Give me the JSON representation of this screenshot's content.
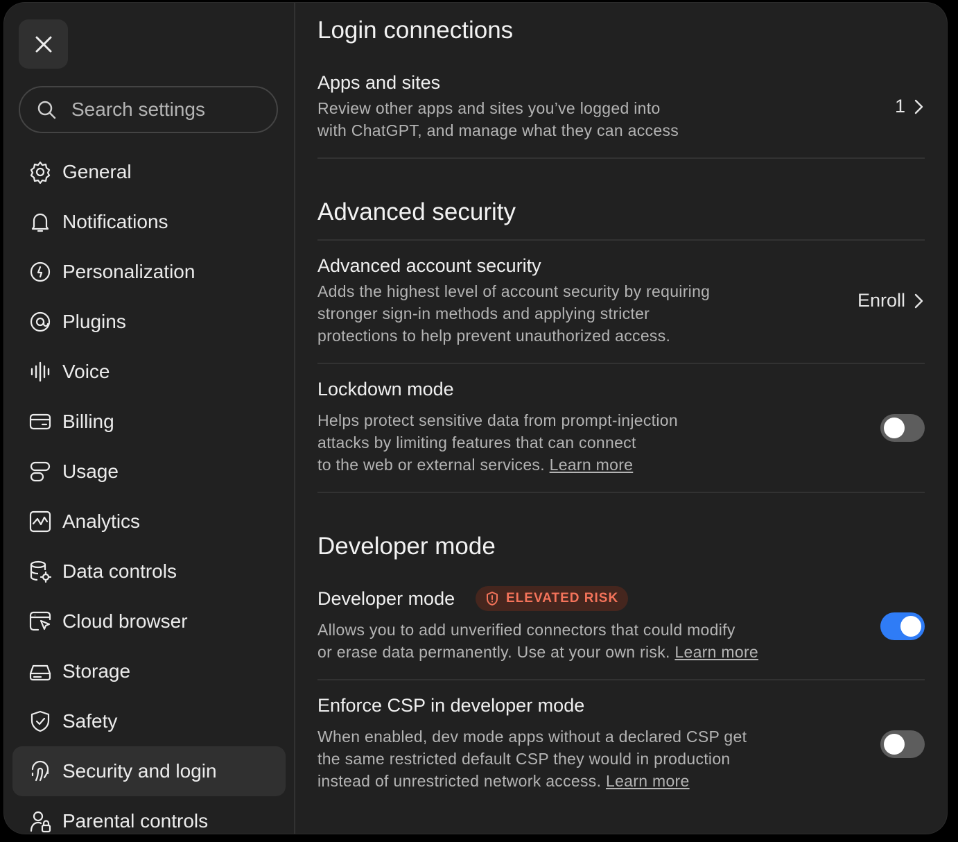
{
  "sidebar": {
    "search_placeholder": "Search settings",
    "items": [
      {
        "label": "General",
        "icon": "gear-icon"
      },
      {
        "label": "Notifications",
        "icon": "bell-icon"
      },
      {
        "label": "Personalization",
        "icon": "personalization-icon"
      },
      {
        "label": "Plugins",
        "icon": "plugins-icon"
      },
      {
        "label": "Voice",
        "icon": "voice-waveform-icon"
      },
      {
        "label": "Billing",
        "icon": "credit-card-icon"
      },
      {
        "label": "Usage",
        "icon": "usage-icon"
      },
      {
        "label": "Analytics",
        "icon": "analytics-chart-icon"
      },
      {
        "label": "Data controls",
        "icon": "database-gear-icon"
      },
      {
        "label": "Cloud browser",
        "icon": "cloud-browser-cursor-icon"
      },
      {
        "label": "Storage",
        "icon": "storage-drive-icon"
      },
      {
        "label": "Safety",
        "icon": "shield-check-icon"
      },
      {
        "label": "Security and login",
        "icon": "fingerprint-icon",
        "active": true
      },
      {
        "label": "Parental controls",
        "icon": "user-lock-icon"
      }
    ]
  },
  "main": {
    "login_connections": {
      "heading": "Login connections",
      "apps": {
        "title": "Apps and sites",
        "desc_line1": "Review other apps and sites you’ve logged into",
        "desc_line2": "with ChatGPT, and manage what they can access",
        "count": "1"
      }
    },
    "advanced_security": {
      "heading": "Advanced security",
      "account": {
        "title": "Advanced account security",
        "desc_line1": "Adds the highest level of account security by requiring",
        "desc_line2": "stronger sign-in methods and applying stricter",
        "desc_line3": "protections to help prevent unauthorized access.",
        "action": "Enroll"
      },
      "lockdown": {
        "title": "Lockdown mode",
        "desc_line1": "Helps protect sensitive data from prompt-injection",
        "desc_line2": "attacks by limiting features that can connect",
        "desc_line3": "to the web or external services.",
        "link": "Learn more",
        "enabled": false
      }
    },
    "developer": {
      "heading": "Developer mode",
      "mode": {
        "title": "Developer mode",
        "badge": "ELEVATED RISK",
        "desc_line1": "Allows you to add unverified connectors that could modify",
        "desc_line2": "or erase data permanently. Use at your own risk.",
        "link": "Learn more",
        "enabled": true
      },
      "csp": {
        "title": "Enforce CSP in developer mode",
        "desc_line1": "When enabled, dev mode apps without a declared CSP get",
        "desc_line2": "the same restricted default CSP they would in production",
        "desc_line3": "instead of unrestricted network access.",
        "link": "Learn more",
        "enabled": false
      }
    }
  },
  "colors": {
    "background": "#212121",
    "toggle_on": "#2f7cf6",
    "toggle_off": "#5d5d5d",
    "badge_text": "#f4735a",
    "badge_bg": "#45261e"
  }
}
